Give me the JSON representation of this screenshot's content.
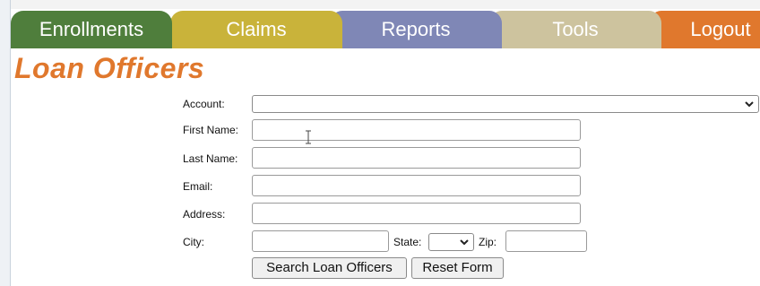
{
  "nav": {
    "tabs": [
      {
        "label": "Enrollments",
        "color": "#4f7e3c"
      },
      {
        "label": "Claims",
        "color": "#c9b33a"
      },
      {
        "label": "Reports",
        "color": "#7f87b6"
      },
      {
        "label": "Tools",
        "color": "#cdc39e"
      },
      {
        "label": "Logout",
        "color": "#e0782d"
      }
    ]
  },
  "page": {
    "title": "Loan Officers",
    "title_color": "#e0782d"
  },
  "form": {
    "account": {
      "label": "Account:",
      "value": ""
    },
    "first_name": {
      "label": "First Name:",
      "value": ""
    },
    "last_name": {
      "label": "Last Name:",
      "value": ""
    },
    "email": {
      "label": "Email:",
      "value": ""
    },
    "address": {
      "label": "Address:",
      "value": ""
    },
    "city": {
      "label": "City:",
      "value": ""
    },
    "state": {
      "label": "State:",
      "value": ""
    },
    "zip": {
      "label": "Zip:",
      "value": ""
    },
    "search_button": "Search Loan Officers",
    "reset_button": "Reset Form"
  }
}
